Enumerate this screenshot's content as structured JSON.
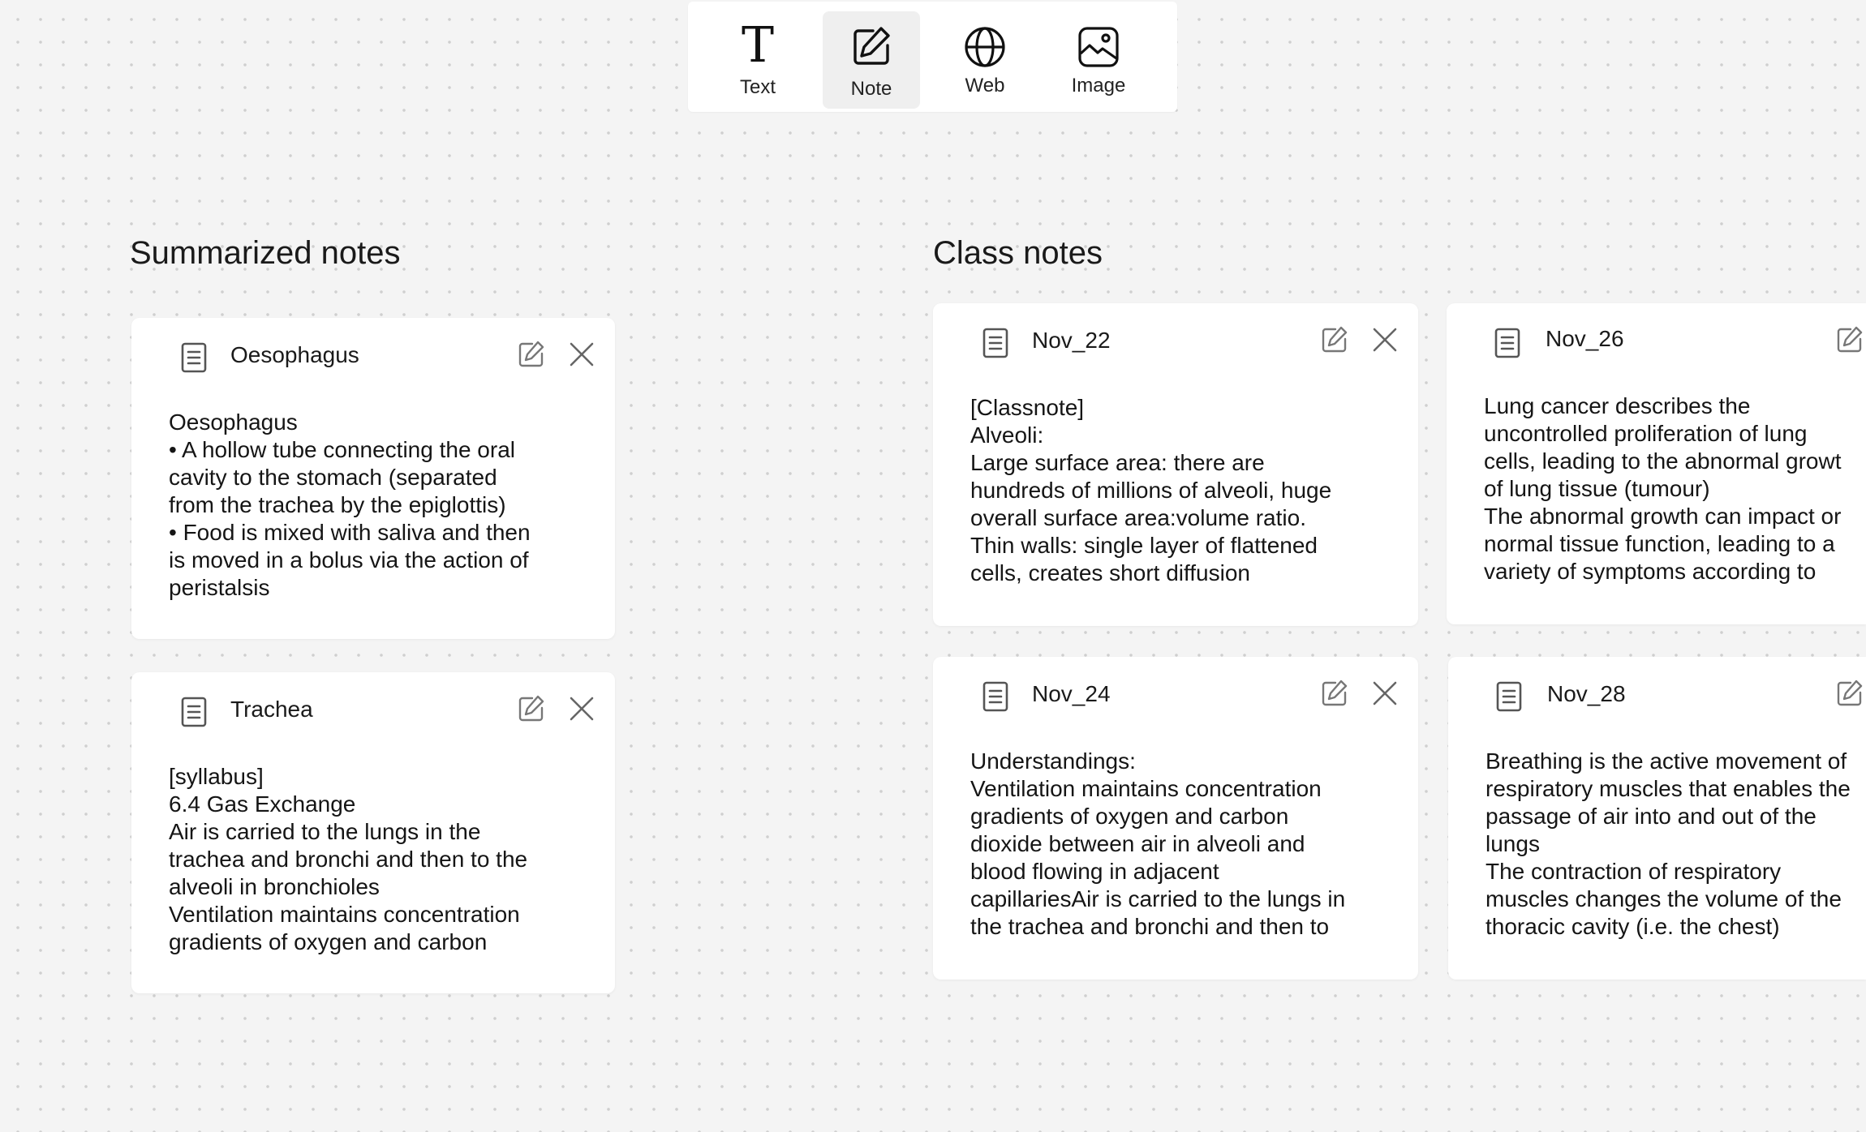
{
  "toolbar": {
    "items": [
      {
        "label": "Text",
        "icon": "text-icon"
      },
      {
        "label": "Note",
        "icon": "note-icon",
        "active": true
      },
      {
        "label": "Web",
        "icon": "globe-icon"
      },
      {
        "label": "Image",
        "icon": "image-icon"
      }
    ]
  },
  "sections": {
    "summarized": {
      "title": "Summarized notes"
    },
    "class": {
      "title": "Class notes"
    }
  },
  "summarized_notes": [
    {
      "title": "Oesophagus",
      "lines": [
        "Oesophagus",
        "•  A hollow tube connecting the oral",
        "cavity to the stomach (separated",
        "from the trachea by the epiglottis)",
        "•  Food is mixed with saliva and then",
        "is moved in a bolus via the action of",
        "peristalsis"
      ]
    },
    {
      "title": "Trachea",
      "lines": [
        "[syllabus]",
        "6.4 Gas Exchange",
        "Air is carried to the lungs in the",
        "trachea and bronchi and then to the",
        "alveoli in bronchioles",
        "Ventilation maintains concentration",
        "gradients of oxygen and carbon"
      ]
    }
  ],
  "class_notes": [
    {
      "title": "Nov_22",
      "lines": [
        "[Classnote]",
        "Alveoli:",
        "Large surface area: there are",
        "hundreds of millions of alveoli, huge",
        "overall surface area:volume ratio.",
        "Thin walls: single layer of flattened",
        "cells, creates short diffusion"
      ]
    },
    {
      "title": "Nov_26",
      "lines": [
        "Lung cancer describes the",
        "uncontrolled proliferation of lung",
        "cells, leading to the abnormal growt",
        "of lung tissue (tumour)",
        "The abnormal growth can impact or",
        "normal tissue function, leading to a",
        "variety of symptoms according to"
      ]
    },
    {
      "title": "Nov_24",
      "lines": [
        "Understandings:",
        "Ventilation maintains concentration",
        "gradients of oxygen and carbon",
        "dioxide between air in alveoli and",
        "blood flowing in adjacent",
        "capillariesAir is carried to the lungs in",
        "the trachea and bronchi and then to"
      ]
    },
    {
      "title": "Nov_28",
      "lines": [
        "Breathing is the active movement of",
        "respiratory muscles that enables the",
        "passage of air into and out of the",
        "lungs",
        "The contraction of respiratory",
        "muscles changes the volume of the",
        "thoracic cavity (i.e. the chest)"
      ]
    }
  ]
}
